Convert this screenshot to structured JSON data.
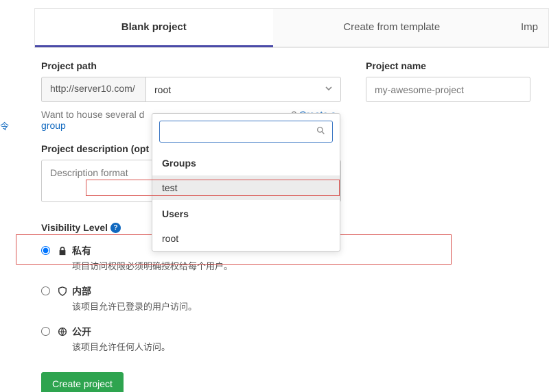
{
  "left_edge_text": "令",
  "tabs": {
    "blank": "Blank project",
    "template": "Create from template",
    "import": "Imp"
  },
  "path": {
    "label": "Project path",
    "prefix": "http://server10.com/",
    "selected": "root"
  },
  "name": {
    "label": "Project name",
    "placeholder": "my-awesome-project"
  },
  "hint": {
    "prefix": "Want to house several d",
    "gap_tail": "? ",
    "link": "Create a group"
  },
  "desc": {
    "label": "Project description (opt",
    "placeholder": "Description format"
  },
  "dropdown": {
    "groups_header": "Groups",
    "users_header": "Users",
    "item_test": "test",
    "item_root": "root"
  },
  "visibility": {
    "label": "Visibility Level",
    "private": {
      "title": "私有",
      "desc": "项目访问权限必须明确授权给每个用户。"
    },
    "internal": {
      "title": "内部",
      "desc": "该项目允许已登录的用户访问。"
    },
    "public": {
      "title": "公开",
      "desc": "该项目允许任何人访问。"
    }
  },
  "buttons": {
    "create": "Create project"
  }
}
